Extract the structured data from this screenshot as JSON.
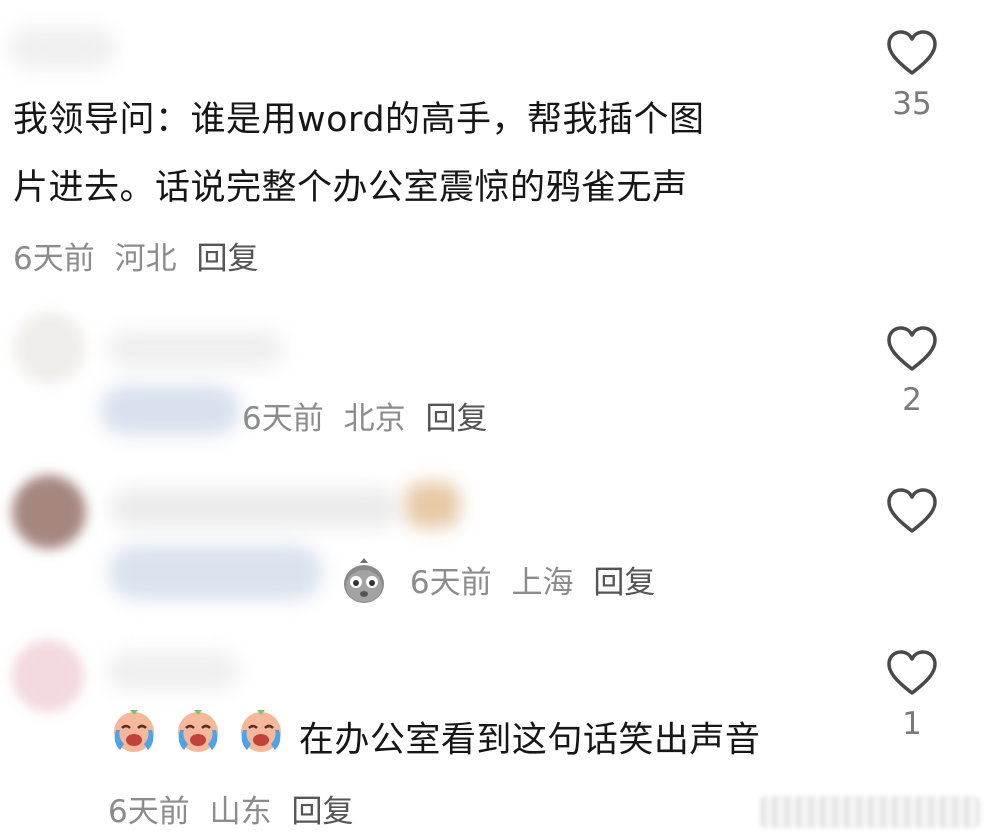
{
  "comments": [
    {
      "text_line1": "我领导问：谁是用word的高手，帮我插个图",
      "text_line2": "片进去。话说完整个办公室震惊的鸦雀无声",
      "time": "6天前",
      "location": "河北",
      "reply": "回复",
      "likes": "35"
    },
    {
      "time": "6天前",
      "location": "北京",
      "reply": "回复",
      "likes": "2"
    },
    {
      "time": "6天前",
      "location": "上海",
      "reply": "回复",
      "likes": ""
    },
    {
      "text": "在办公室看到这句话笑出声音",
      "time": "6天前",
      "location": "山东",
      "reply": "回复",
      "likes": "1"
    }
  ],
  "icons": {
    "like": "heart-outline-icon",
    "laugh_cry": "laugh-cry-emoji-icon",
    "shocked": "shocked-face-emoji-icon"
  },
  "colors": {
    "text": "#161616",
    "meta": "#8c8c8c",
    "icon": "#4a4a4a"
  }
}
